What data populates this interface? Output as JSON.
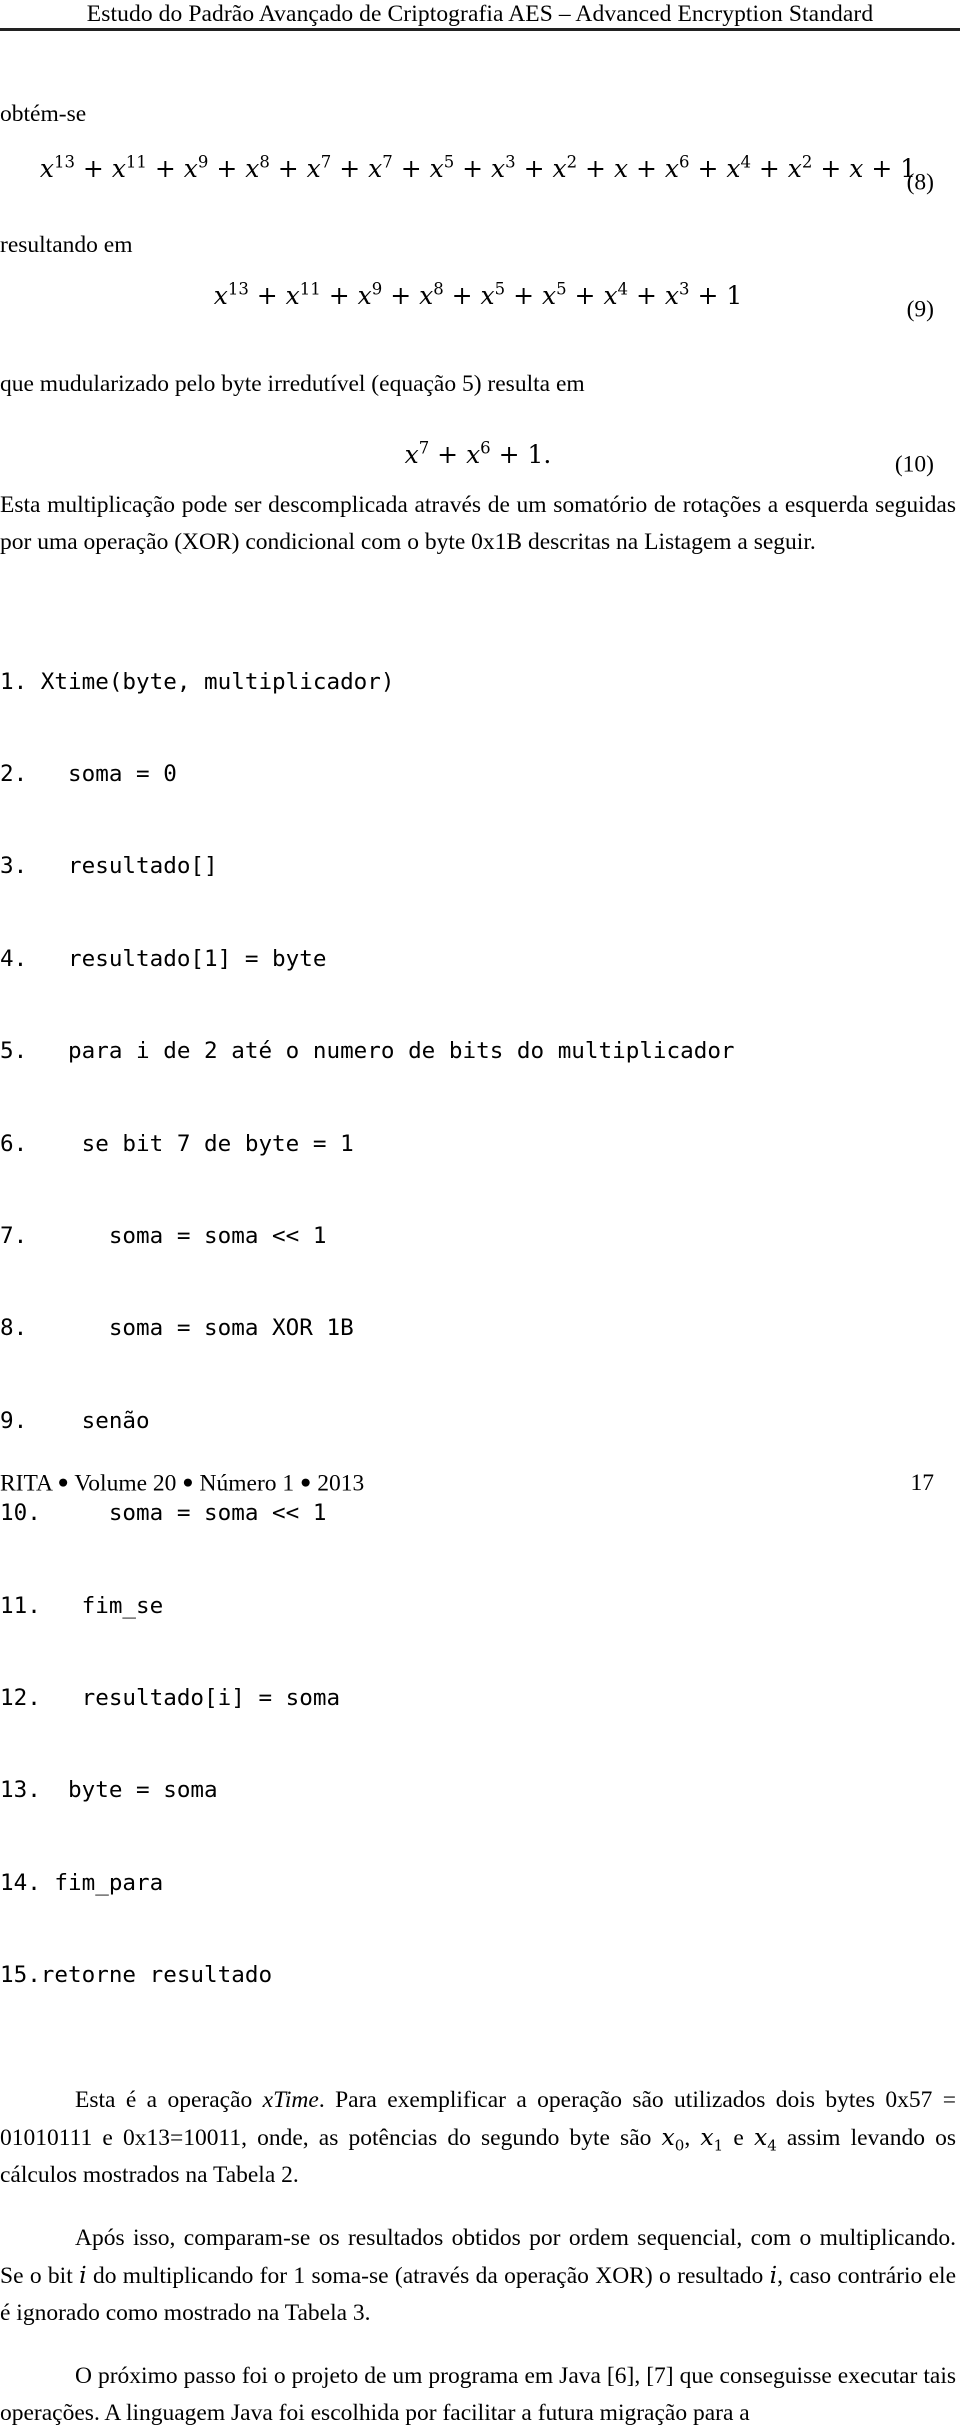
{
  "header": {
    "title": "Estudo do Padrão Avançado de Criptografia AES – Advanced Encryption Standard"
  },
  "intro": {
    "obtem": "obtém-se",
    "resultando": "resultando em",
    "modularizado": "que mudularizado pelo byte irredutível (equação  5) resulta em"
  },
  "equations": [
    {
      "id": "eq8",
      "number": "(8)",
      "plain": "x^13 + x^11 + x^9 + x^8 + x^7 + x^7 + x^5 + x^3 + x^2 + x + x^6 + x^4 + x^2 + x + 1",
      "terms": [
        "13",
        "11",
        "9",
        "8",
        "7",
        "7",
        "5",
        "3",
        "2",
        "1",
        "6",
        "4",
        "2",
        "1",
        "const"
      ]
    },
    {
      "id": "eq9",
      "number": "(9)",
      "plain": "x^13 + x^11 + x^9 + x^8 + x^5 + x^5 + x^4 + x^3 + 1",
      "terms": [
        "13",
        "11",
        "9",
        "8",
        "5",
        "5",
        "4",
        "3",
        "const"
      ]
    },
    {
      "id": "eq10",
      "number": "(10)",
      "plain": "x^7 + x^6 + 1.",
      "terms": [
        "7",
        "6",
        "const"
      ]
    }
  ],
  "paragraph_xtime_intro": "Esta multiplicação pode ser descomplicada através de um somatório de rotações a esquerda seguidas por uma operação (XOR) condicional com o byte 0x1B descritas na Listagem a seguir.",
  "listing": {
    "lines": [
      "1. Xtime(byte, multiplicador)",
      "2.   soma = 0",
      "3.   resultado[]",
      "4.   resultado[1] = byte",
      "5.   para i de 2 até o numero de bits do multiplicador",
      "6.    se bit 7 de byte = 1",
      "7.      soma = soma << 1",
      "8.      soma = soma XOR 1B",
      "9.    senão",
      "10.     soma = soma << 1",
      "11.   fim_se",
      "12.   resultado[i] = soma",
      "13.  byte = soma",
      "14. fim_para",
      "15.retorne resultado"
    ]
  },
  "paragraphs": {
    "p1_a": "Esta é a operação ",
    "p1_xtime": "xTime",
    "p1_b": ". Para exemplificar a operação são utilizados dois bytes 0x57 = 01010111 e 0x13=10011, onde, as potências do segundo byte são ",
    "p1_x0": "x",
    "p1_x0_sub": "0",
    "p1_c": ", ",
    "p1_x1": "x",
    "p1_x1_sub": "1",
    "p1_d": " e ",
    "p1_x4": "x",
    "p1_x4_sub": "4",
    "p1_e": " assim levando os cálculos mostrados na Tabela 2.",
    "p2_a": "Após isso, comparam-se os resultados obtidos por ordem sequencial, com o multiplicando.  Se o bit ",
    "p2_i1": "i",
    "p2_b": " do multiplicando for 1 soma-se (através da operação XOR) o resultado ",
    "p2_i2": "i",
    "p2_c": ", caso contrário ele é ignorado como mostrado na Tabela 3.",
    "p3": "O próximo passo foi o projeto de um programa em Java [6], [7] que conseguisse executar tais operações.  A linguagem Java foi escolhida por facilitar a futura migração para a"
  },
  "footer": {
    "journal": "RITA",
    "volume": "Volume 20",
    "issue": "Número 1",
    "year": "2013",
    "page": "17",
    "separator": "●"
  },
  "colors": {
    "text": "#000000",
    "rule": "#222222",
    "background": "#ffffff"
  }
}
